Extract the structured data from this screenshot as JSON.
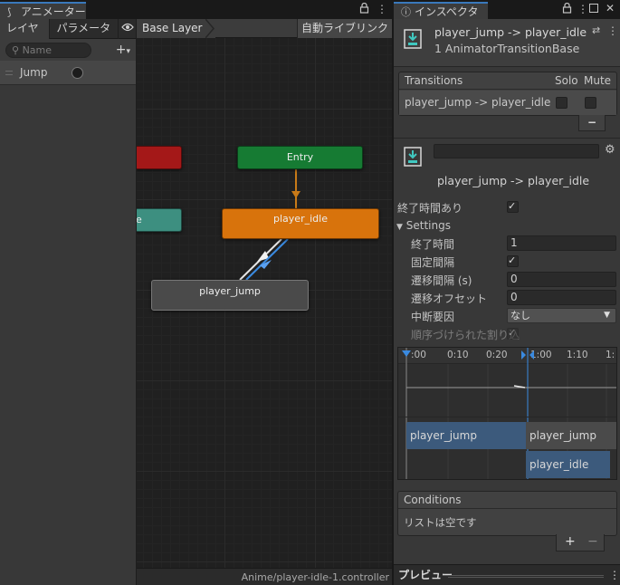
{
  "animator": {
    "tab_label": "アニメーター",
    "tab_icon": "animator-icon",
    "sub_tabs": {
      "layers": "レイヤー",
      "parameters": "パラメーター"
    },
    "search_placeholder": "Name",
    "layers": [
      {
        "name": "Jump"
      }
    ],
    "breadcrumb": "Base Layer",
    "auto_live_link": "自動ライブリンク",
    "states": {
      "entry": "Entry",
      "player_idle": "player_idle",
      "player_jump": "player_jump",
      "partial_teal": "e"
    },
    "colors": {
      "entry": "#167b33",
      "idle": "#d8730c",
      "jump": "#4a4a4a",
      "any_state": "#3d8f80",
      "exit": "#a41818",
      "selected_transition": "#3a8ae0"
    },
    "footer_path": "Anime/player-idle-1.controller"
  },
  "inspector": {
    "tab_label": "インスペクター",
    "tab_icon": "info-icon",
    "title": "player_jump -> player_idle",
    "subtitle": "1 AnimatorTransitionBase",
    "transitions_header": "Transitions",
    "solo_label": "Solo",
    "mute_label": "Mute",
    "transition_row": "player_jump -> player_idle",
    "minus": "−",
    "name_field": "",
    "transition_name": "player_jump -> player_idle",
    "has_exit_time_label": "終了時間あり",
    "has_exit_time": true,
    "settings_label": "Settings",
    "settings": {
      "exit_time_label": "終了時間",
      "exit_time": "1",
      "fixed_duration_label": "固定間隔",
      "fixed_duration": true,
      "duration_label": "遷移間隔 (s)",
      "duration": "0",
      "offset_label": "遷移オフセット",
      "offset": "0",
      "interruption_label": "中断要因",
      "interruption": "なし",
      "ordered_label": "順序づけられた割り込",
      "ordered": true
    },
    "timeline": {
      "ticks": [
        ":00",
        "0:10",
        "0:20",
        "1:00",
        "1:10",
        "1:"
      ],
      "clips": {
        "jump_a": "player_jump",
        "jump_b": "player_jump",
        "idle": "player_idle"
      }
    },
    "conditions_header": "Conditions",
    "conditions_empty": "リストは空です",
    "plus": "+",
    "preview_label": "プレビュー"
  }
}
